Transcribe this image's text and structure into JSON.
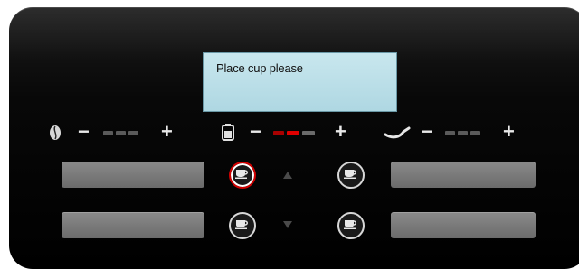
{
  "display": {
    "message": "Place cup please"
  },
  "selectors": [
    {
      "name": "coffee-strength",
      "icon": "bean-icon",
      "minus": "−",
      "plus": "+",
      "levels": 3,
      "active": 0
    },
    {
      "name": "coffee-volume",
      "icon": "pot-icon",
      "minus": "−",
      "plus": "+",
      "levels": 3,
      "active": 2
    },
    {
      "name": "milk-amount",
      "icon": "milk-jug-icon",
      "minus": "−",
      "plus": "+",
      "levels": 3,
      "active": 0
    }
  ],
  "buttons": {
    "cup_top_left": {
      "icon": "cup-icon",
      "selected": true
    },
    "cup_top_right": {
      "icon": "cup-icon",
      "selected": false
    },
    "cup_bottom_left": {
      "icon": "cup-icon",
      "selected": false
    },
    "cup_bottom_right": {
      "icon": "cup-icon",
      "selected": false
    },
    "arrow_up": {
      "icon": "arrow-up-icon"
    },
    "arrow_down": {
      "icon": "arrow-down-icon"
    }
  },
  "colors": {
    "accent_red": "#e00000",
    "display_bg": "#b9dfe8",
    "panel_bg": "#000000"
  }
}
